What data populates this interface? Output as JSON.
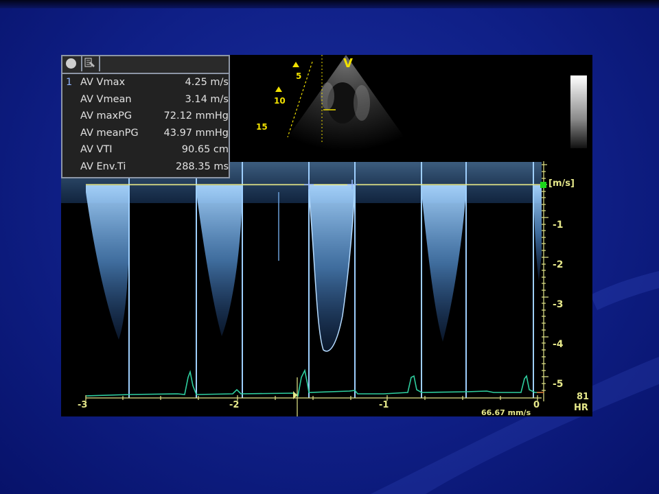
{
  "measurements": [
    {
      "index": "1",
      "label": "AV Vmax",
      "value": "4.25 m/s"
    },
    {
      "index": "",
      "label": "AV Vmean",
      "value": "3.14 m/s"
    },
    {
      "index": "",
      "label": "AV maxPG",
      "value": "72.12 mmHg"
    },
    {
      "index": "",
      "label": "AV meanPG",
      "value": "43.97 mmHg"
    },
    {
      "index": "",
      "label": "AV VTI",
      "value": "90.65 cm"
    },
    {
      "index": "",
      "label": "AV Env.Ti",
      "value": "288.35 ms"
    }
  ],
  "echo_view": {
    "marker": "V",
    "depths": [
      "5",
      "10",
      "15"
    ]
  },
  "velocity_axis": {
    "unit": "[m/s]",
    "ticks": [
      "-1",
      "-2",
      "-3",
      "-4",
      "-5"
    ]
  },
  "time_axis": {
    "ticks": [
      "-3",
      "-2",
      "-1",
      "0"
    ]
  },
  "sweep_speed": "66.67 mm/s",
  "heart_rate": {
    "value": "81",
    "label": "HR"
  },
  "colors": {
    "doppler": "#7fc0ff",
    "ecg": "#2fd0a0",
    "axis": "#e6e88a",
    "marker": "#f0e000"
  }
}
